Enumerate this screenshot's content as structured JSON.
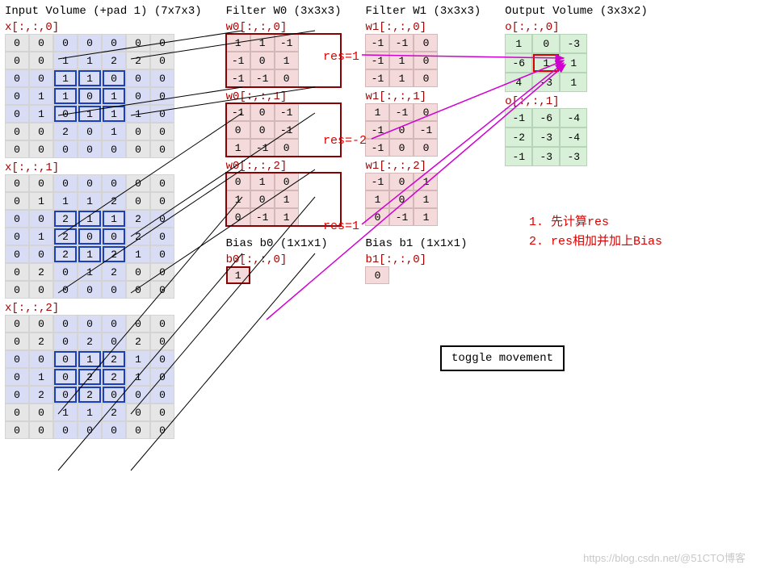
{
  "input": {
    "title": "Input Volume (+pad 1) (7x7x3)",
    "slices": [
      {
        "label": "x[:,:,0]",
        "data": [
          [
            0,
            0,
            0,
            0,
            0,
            0,
            0
          ],
          [
            0,
            0,
            1,
            1,
            2,
            2,
            0
          ],
          [
            0,
            0,
            1,
            1,
            0,
            0,
            0
          ],
          [
            0,
            1,
            1,
            0,
            1,
            0,
            0
          ],
          [
            0,
            1,
            0,
            1,
            1,
            1,
            0
          ],
          [
            0,
            0,
            2,
            0,
            1,
            0,
            0
          ],
          [
            0,
            0,
            0,
            0,
            0,
            0,
            0
          ]
        ]
      },
      {
        "label": "x[:,:,1]",
        "data": [
          [
            0,
            0,
            0,
            0,
            0,
            0,
            0
          ],
          [
            0,
            1,
            1,
            1,
            2,
            0,
            0
          ],
          [
            0,
            0,
            2,
            1,
            1,
            2,
            0
          ],
          [
            0,
            1,
            2,
            0,
            0,
            2,
            0
          ],
          [
            0,
            0,
            2,
            1,
            2,
            1,
            0
          ],
          [
            0,
            2,
            0,
            1,
            2,
            0,
            0
          ],
          [
            0,
            0,
            0,
            0,
            0,
            0,
            0
          ]
        ]
      },
      {
        "label": "x[:,:,2]",
        "data": [
          [
            0,
            0,
            0,
            0,
            0,
            0,
            0
          ],
          [
            0,
            2,
            0,
            2,
            0,
            2,
            0
          ],
          [
            0,
            0,
            0,
            1,
            2,
            1,
            0
          ],
          [
            0,
            1,
            0,
            2,
            2,
            1,
            0
          ],
          [
            0,
            2,
            0,
            2,
            0,
            0,
            0
          ],
          [
            0,
            0,
            1,
            1,
            2,
            0,
            0
          ],
          [
            0,
            0,
            0,
            0,
            0,
            0,
            0
          ]
        ]
      }
    ],
    "highlight_rows": [
      2,
      3,
      4
    ],
    "highlight_cols": [
      2,
      3,
      4
    ]
  },
  "filter0": {
    "title": "Filter W0 (3x3x3)",
    "slices": [
      {
        "label": "w0[:,:,0]",
        "data": [
          [
            1,
            1,
            -1
          ],
          [
            -1,
            0,
            1
          ],
          [
            -1,
            -1,
            0
          ]
        ]
      },
      {
        "label": "w0[:,:,1]",
        "data": [
          [
            -1,
            0,
            -1
          ],
          [
            0,
            0,
            -1
          ],
          [
            1,
            -1,
            0
          ]
        ]
      },
      {
        "label": "w0[:,:,2]",
        "data": [
          [
            0,
            1,
            0
          ],
          [
            1,
            0,
            1
          ],
          [
            0,
            -1,
            1
          ]
        ]
      }
    ],
    "bias_title": "Bias b0 (1x1x1)",
    "bias_label": "b0[:,:,0]",
    "bias": [
      1
    ]
  },
  "filter1": {
    "title": "Filter W1 (3x3x3)",
    "slices": [
      {
        "label": "w1[:,:,0]",
        "data": [
          [
            -1,
            -1,
            0
          ],
          [
            -1,
            1,
            0
          ],
          [
            -1,
            1,
            0
          ]
        ]
      },
      {
        "label": "w1[:,:,1]",
        "data": [
          [
            1,
            -1,
            0
          ],
          [
            -1,
            0,
            -1
          ],
          [
            -1,
            0,
            0
          ]
        ]
      },
      {
        "label": "w1[:,:,2]",
        "data": [
          [
            -1,
            0,
            1
          ],
          [
            1,
            0,
            1
          ],
          [
            0,
            -1,
            1
          ]
        ]
      }
    ],
    "bias_title": "Bias b1 (1x1x1)",
    "bias_label": "b1[:,:,0]",
    "bias": [
      0
    ]
  },
  "output": {
    "title": "Output Volume (3x3x2)",
    "slices": [
      {
        "label": "o[:,:,0]",
        "data": [
          [
            1,
            0,
            -3
          ],
          [
            -6,
            1,
            1
          ],
          [
            4,
            -3,
            1
          ]
        ],
        "highlight": [
          1,
          1
        ]
      },
      {
        "label": "o[:,:,1]",
        "data": [
          [
            -1,
            -6,
            -4
          ],
          [
            -2,
            -3,
            -4
          ],
          [
            -1,
            -3,
            -3
          ]
        ]
      }
    ]
  },
  "res_labels": [
    "res=1",
    "res=-2",
    "res=1"
  ],
  "notes": [
    "1. 先计算res",
    "2. res相加并加上Bias"
  ],
  "toggle_label": "toggle movement",
  "watermark": "https://blog.csdn.net/@51CTO博客"
}
